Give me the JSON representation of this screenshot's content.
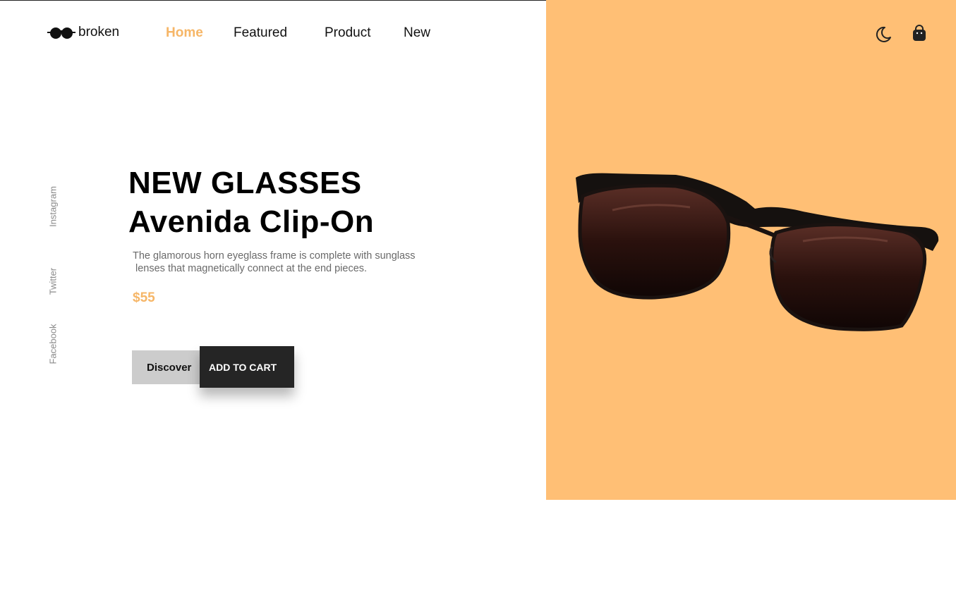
{
  "brand": {
    "name": "broken",
    "logo_icon": "sunglasses-logo-icon"
  },
  "nav": {
    "items": [
      {
        "label": "Home",
        "active": true
      },
      {
        "label": "Featured",
        "active": false
      },
      {
        "label": "Product",
        "active": false
      },
      {
        "label": "New",
        "active": false
      }
    ]
  },
  "header_icons": {
    "theme_toggle": "moon-icon",
    "cart": "shopping-bag-icon"
  },
  "social": {
    "links": [
      "Instagram",
      "Twitter",
      "Facebook"
    ]
  },
  "hero": {
    "title_line1": "NEW GLASSES",
    "title_line2": "Avenida Clip-On",
    "description_line1": "The glamorous horn eyeglass frame is complete with sunglass",
    "description_line2": "lenses that magnetically connect at the end pieces.",
    "price": "$55",
    "discover_label": "Discover",
    "add_to_cart_label": "ADD TO CART",
    "product_image": "sunglasses-product-image"
  },
  "colors": {
    "accent": "#f6b667",
    "panel": "#ffbf75",
    "dark_button": "#252525",
    "light_button": "#cccccc",
    "muted_text": "#8a8a8a"
  }
}
